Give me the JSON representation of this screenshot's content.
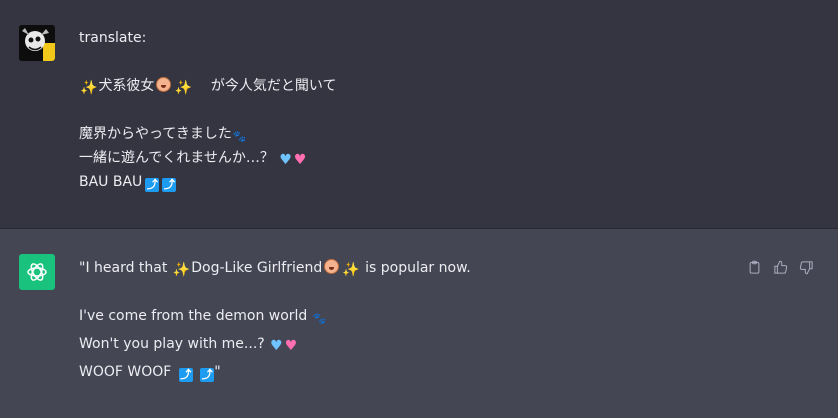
{
  "user_message": {
    "line1": "translate:",
    "line2_prefix": "犬系彼女",
    "line2_suffix": "が今人気だと聞いて",
    "line3": "魔界からやってきました",
    "line4": "一緒に遊んでくれませんか…？",
    "line5": "BAU BAU"
  },
  "assistant_message": {
    "line1_prefix": "\"I heard that ",
    "line1_middle": "Dog-Like Girlfriend",
    "line1_suffix": " is popular now.",
    "line2": "I've come from the demon world",
    "line3": "Won't you play with me...?",
    "line4": "WOOF WOOF",
    "line4_end": "\""
  },
  "icons": {
    "sparkle": "sparkles-icon",
    "face": "screaming-face-icon",
    "paw": "paw-prints-icon",
    "blue_heart": "blue-heart-icon",
    "pink_heart": "pink-heart-icon",
    "arrow": "arrow-right-hook-up-icon",
    "copy": "clipboard-icon",
    "thumbs_up": "thumbs-up-icon",
    "thumbs_down": "thumbs-down-icon"
  },
  "colors": {
    "user_bg": "#343541",
    "assistant_bg": "#444654",
    "gpt_green": "#19c37d",
    "text": "#ececf1"
  }
}
